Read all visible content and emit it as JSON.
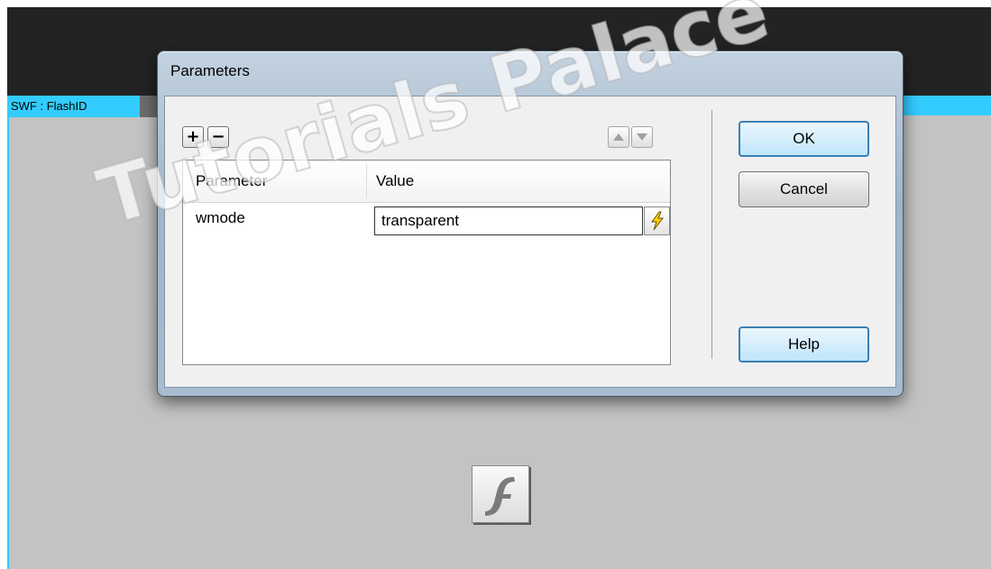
{
  "workspace": {
    "swf_label": "SWF : FlashID"
  },
  "dialog": {
    "title": "Parameters",
    "toolbar": {
      "add_label": "+",
      "remove_label": "−",
      "move_up_icon": "triangle-up-icon",
      "move_down_icon": "triangle-down-icon"
    },
    "table": {
      "columns": [
        "Parameter",
        "Value"
      ],
      "rows": [
        {
          "parameter": "wmode",
          "value": "transparent"
        }
      ]
    },
    "buttons": {
      "ok_label": "OK",
      "cancel_label": "Cancel",
      "help_label": "Help"
    }
  },
  "watermark": {
    "text": "Tutorials Palace"
  },
  "icons": {
    "flash": "flash-player-icon",
    "lightning": "lightning-icon"
  },
  "colors": {
    "accent_cyan": "#33ccff",
    "dark_bar": "#232323",
    "canvas_gray": "#c3c3c3",
    "lightning_yellow": "#ffd200"
  }
}
